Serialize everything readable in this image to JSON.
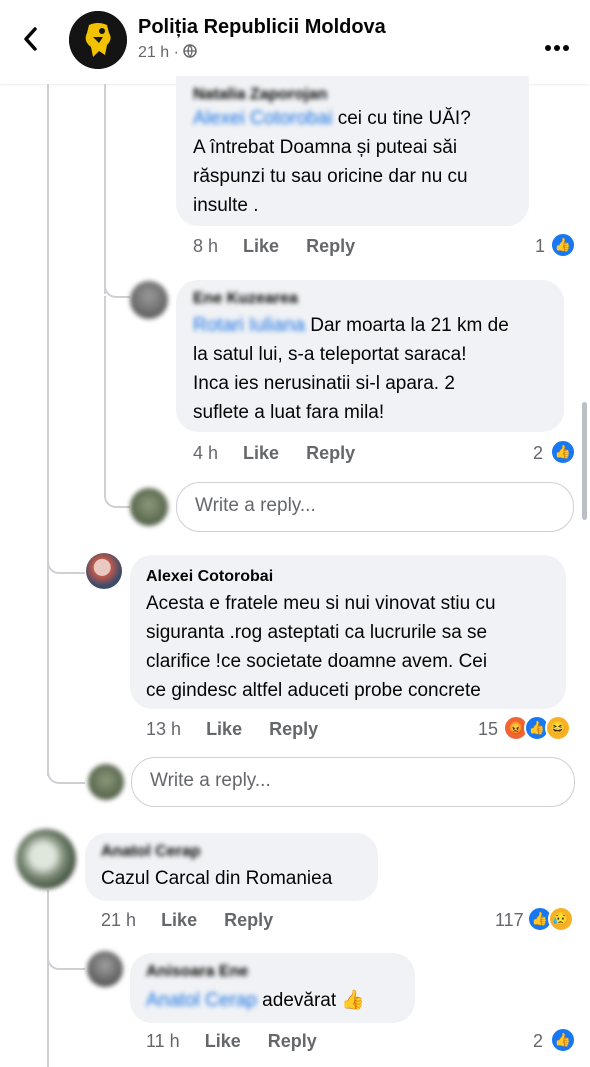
{
  "header": {
    "back_icon": "chevron-left-icon",
    "page_name": "Poliția Republicii Moldova",
    "time": "21 h ·",
    "audience_icon": "globe-icon",
    "more_icon": "more-icon"
  },
  "comments": [
    {
      "author": "Natalia Zaporojan",
      "mention": "Alexei Cotorobai",
      "lines": [
        " cei cu tine UĂI?",
        "A întrebat Doamna și puteai săi",
        "răspunzi tu sau oricine dar nu cu",
        "insulte ."
      ],
      "time": "8 h",
      "like": "Like",
      "reply": "Reply",
      "reactions": "1"
    },
    {
      "author": "Ene Kuzearea",
      "mention": "Rotari Iuliana",
      "lines": [
        " Dar moarta la 21 km de",
        "la satul lui, s-a teleportat saraca!",
        "Inca ies nerusinatii si-l apara. 2",
        "suflete a luat fara mila!"
      ],
      "time": "4 h",
      "like": "Like",
      "reply": "Reply",
      "reactions": "2"
    },
    {
      "author": "Alexei Cotorobai",
      "lines": [
        "Acesta e fratele meu si nui vinovat stiu cu",
        "siguranta .rog asteptati ca lucrurile sa se",
        "clarifice !ce societate doamne avem. Cei",
        "ce gindesc altfel aduceti probe concrete"
      ],
      "time": "13 h",
      "like": "Like",
      "reply": "Reply",
      "reactions": "15"
    },
    {
      "author": "Anatol Cerap",
      "lines": [
        "Cazul Carcal din Romaniea"
      ],
      "time": "21 h",
      "like": "Like",
      "reply": "Reply",
      "reactions": "117"
    },
    {
      "author": "Anisoara Ene",
      "mention": "Anatol Cerap",
      "lines": [
        " adevărat 👍"
      ],
      "time": "11 h",
      "like": "Like",
      "reply": "Reply",
      "reactions": "2"
    }
  ],
  "reply_placeholder": "Write a reply..."
}
